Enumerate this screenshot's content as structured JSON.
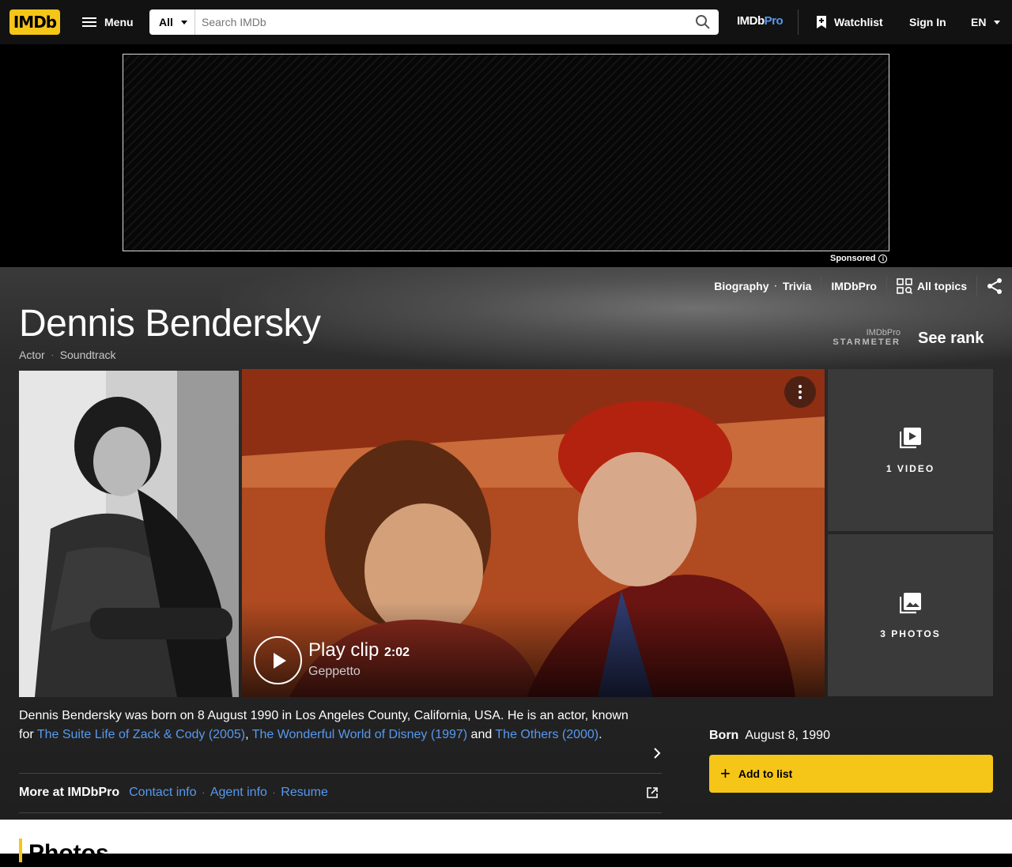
{
  "nav": {
    "logo": "IMDb",
    "menu_label": "Menu",
    "search_category": "All",
    "search_placeholder": "Search IMDb",
    "imdbpro_a": "IMDb",
    "imdbpro_b": "Pro",
    "watchlist": "Watchlist",
    "signin": "Sign In",
    "lang": "EN"
  },
  "ad": {
    "sponsored": "Sponsored"
  },
  "subnav": {
    "items": [
      "Biography",
      "Trivia"
    ],
    "imdbpro": "IMDbPro",
    "all_topics": "All topics"
  },
  "person": {
    "name": "Dennis Bendersky",
    "roles": [
      "Actor",
      "Soundtrack"
    ],
    "starmeter_pro": "IMDbPro",
    "starmeter_label": "STARMETER",
    "see_rank": "See rank"
  },
  "video": {
    "play_label": "Play clip",
    "duration": "2:02",
    "caption": "Geppetto"
  },
  "tiles": {
    "videos": "1 VIDEO",
    "photos": "3 PHOTOS"
  },
  "bio": {
    "text1": "Dennis Bendersky was born on 8 August 1990 in Los Angeles County, California, USA. He is an actor, known for ",
    "link1": "The Suite Life of Zack & Cody (2005)",
    "sep1": ", ",
    "link2": "The Wonderful World of Disney (1997)",
    "sep2": " and ",
    "link3": "The Others (2000)",
    "end": "."
  },
  "more": {
    "label": "More at IMDbPro",
    "links": [
      "Contact info",
      "Agent info",
      "Resume"
    ]
  },
  "born": {
    "label": "Born",
    "value": "August 8, 1990"
  },
  "add_to_list": "Add to list",
  "photos_heading": "Photos",
  "colors": {
    "brand": "#f5c518",
    "link": "#5799ef"
  }
}
